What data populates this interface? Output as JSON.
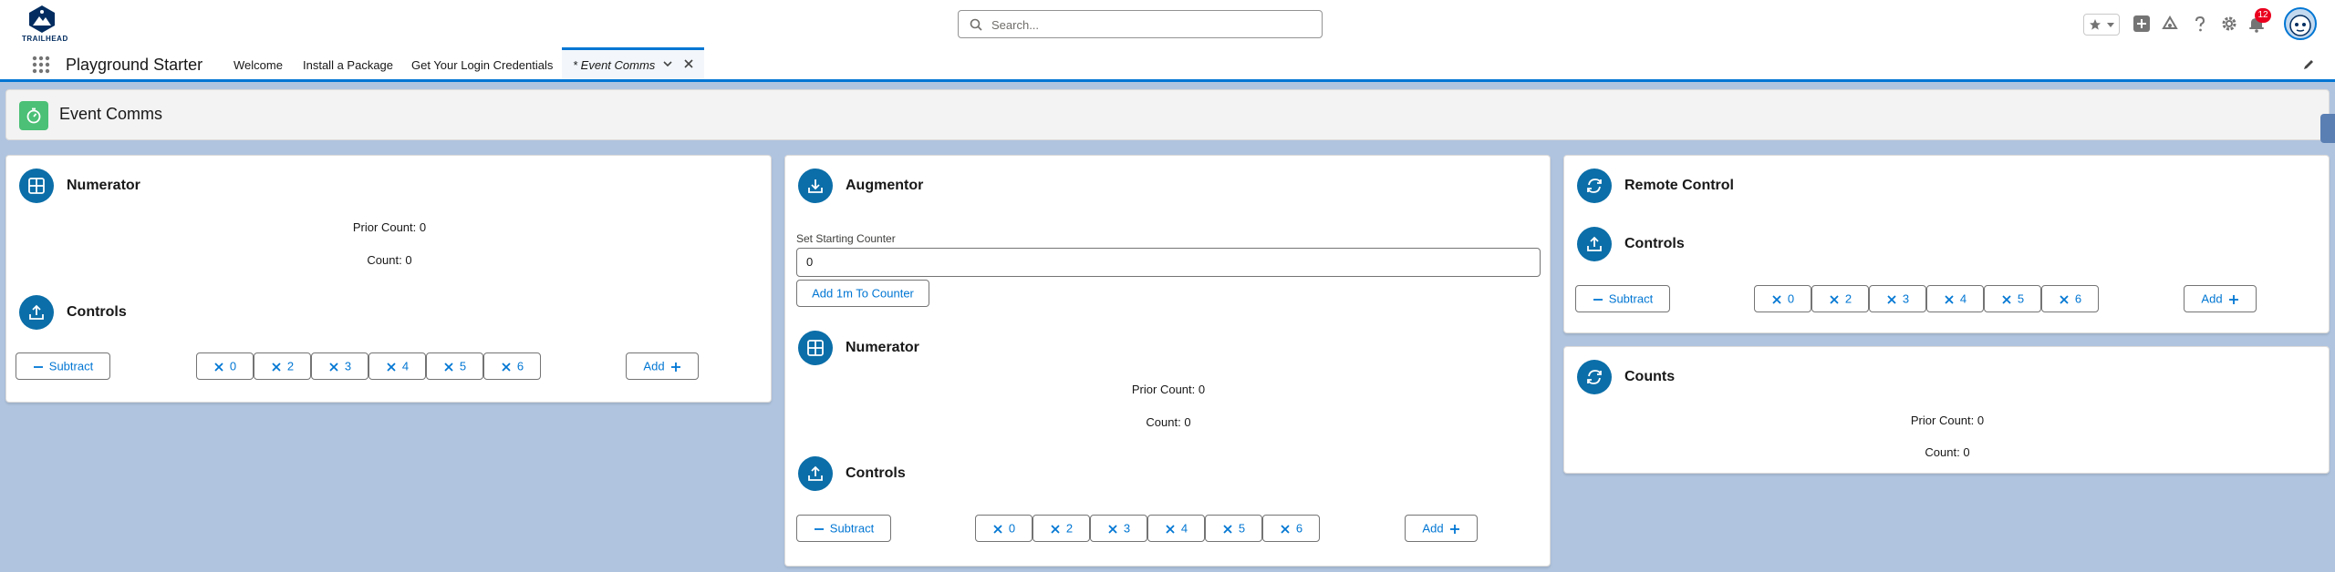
{
  "header": {
    "logo_text": "TRAILHEAD",
    "search_placeholder": "Search...",
    "notification_count": "12"
  },
  "nav": {
    "app_name": "Playground Starter",
    "tabs": [
      {
        "label": "Welcome"
      },
      {
        "label": "Install a Package"
      },
      {
        "label": "Get Your Login Credentials"
      },
      {
        "label": "* Event Comms"
      }
    ]
  },
  "page": {
    "title": "Event Comms"
  },
  "numerator_left": {
    "title": "Numerator",
    "prior_count": "Prior Count: 0",
    "count": "Count: 0",
    "controls_title": "Controls"
  },
  "augmentor": {
    "title": "Augmentor",
    "field_label": "Set Starting Counter",
    "field_value": "0",
    "add_button": "Add 1m To Counter",
    "numerator_title": "Numerator",
    "prior_count": "Prior Count: 0",
    "count": "Count: 0",
    "controls_title": "Controls"
  },
  "remote_control": {
    "title": "Remote Control",
    "controls_title": "Controls"
  },
  "counts": {
    "title": "Counts",
    "prior_count": "Prior Count: 0",
    "count": "Count: 0"
  },
  "controls": {
    "subtract_label": "Subtract",
    "add_label": "Add",
    "multipliers": [
      "0",
      "2",
      "3",
      "4",
      "5",
      "6"
    ]
  },
  "colors": {
    "brand": "#0176d3",
    "icon_bg": "#0b6ea8",
    "page_icon": "#4bc076",
    "background": "#b0c4df"
  }
}
